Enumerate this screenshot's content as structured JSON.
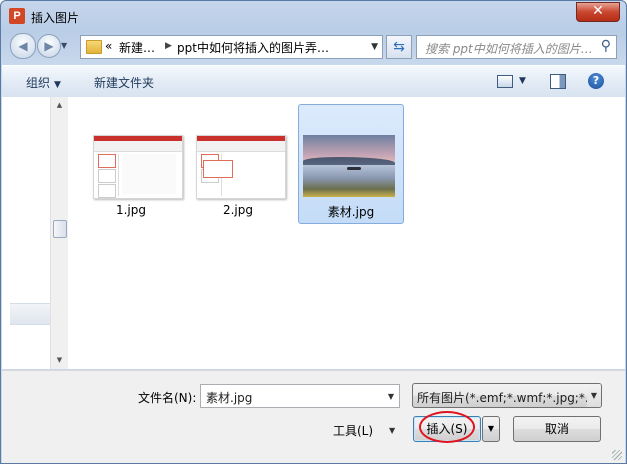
{
  "window": {
    "title": "插入图片",
    "close_label": "✕"
  },
  "nav": {
    "back_icon": "arrow-left-icon",
    "forward_icon": "arrow-right-icon",
    "overflow": "«",
    "crumb1": "新建…",
    "crumb2": "ppt中如何将插入的图片弄…",
    "search_placeholder": "搜索 ppt中如何将插入的图片…"
  },
  "toolbar": {
    "organize": "组织",
    "new_folder": "新建文件夹"
  },
  "files": [
    {
      "name": "1.jpg",
      "type": "slide"
    },
    {
      "name": "2.jpg",
      "type": "slide"
    },
    {
      "name": "素材.jpg",
      "type": "photo",
      "selected": true
    }
  ],
  "bottom": {
    "filename_label": "文件名(N):",
    "filename_value": "素材.jpg",
    "filetype_value": "所有图片(*.emf;*.wmf;*.jpg;*.jp",
    "tools_label": "工具(L)",
    "insert_label": "插入(S)",
    "cancel_label": "取消"
  },
  "colors": {
    "highlight": "#e0141e",
    "selection": "#c4dcf7",
    "accent": "#d24726"
  }
}
